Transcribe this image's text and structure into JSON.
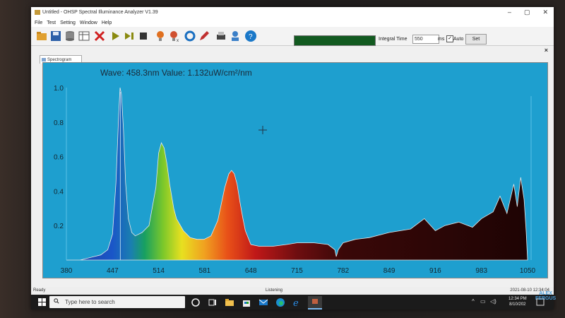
{
  "window": {
    "title": "Untitled - OHSP Spectral Illuminance Analyzer V1.39",
    "controls": [
      "–",
      "▢",
      "✕"
    ]
  },
  "menu": [
    "File",
    "Test",
    "Setting",
    "Window",
    "Help"
  ],
  "toolbar": {
    "icons": [
      "open-icon",
      "save-icon",
      "database-icon",
      "table-icon",
      "delete-icon",
      "play-icon",
      "step-icon",
      "stop-icon",
      "bulb-icon",
      "bulb-x-icon",
      "refresh-icon",
      "edit-icon",
      "print-icon",
      "user-icon",
      "help-icon"
    ],
    "progress": 1.0,
    "integral_time_label": "Integral Time",
    "integral_time_value": "550",
    "ms_label": "ms",
    "auto_label": "Auto",
    "auto_checked": true,
    "set_label": "Set"
  },
  "panel": {
    "close": "×",
    "tab_label": "Spectrogram"
  },
  "readout": "Wave: 458.3nm  Value: 1.132uW/cm²/nm",
  "chart_data": {
    "type": "area",
    "title": "",
    "xlabel": "",
    "ylabel": "",
    "xlim": [
      380,
      1050
    ],
    "ylim": [
      0,
      1.0
    ],
    "x_ticks": [
      "380",
      "447",
      "514",
      "581",
      "648",
      "715",
      "782",
      "849",
      "916",
      "983",
      "1050"
    ],
    "y_ticks": [
      "1.0",
      "0.8",
      "0.6",
      "0.4",
      "0.2"
    ],
    "x": [
      380,
      400,
      420,
      430,
      440,
      447,
      452,
      456,
      458,
      460,
      463,
      466,
      470,
      475,
      480,
      490,
      500,
      510,
      514,
      518,
      522,
      526,
      530,
      536,
      540,
      550,
      560,
      570,
      580,
      590,
      600,
      610,
      616,
      620,
      624,
      628,
      632,
      636,
      640,
      648,
      660,
      680,
      700,
      715,
      740,
      760,
      770,
      772,
      775,
      782,
      800,
      820,
      849,
      880,
      900,
      916,
      930,
      950,
      970,
      983,
      1000,
      1010,
      1020,
      1030,
      1035,
      1040,
      1045,
      1048,
      1050
    ],
    "values": [
      0.0,
      0.0,
      0.02,
      0.03,
      0.06,
      0.15,
      0.45,
      0.85,
      1.0,
      0.96,
      0.75,
      0.45,
      0.24,
      0.16,
      0.14,
      0.16,
      0.2,
      0.42,
      0.62,
      0.68,
      0.65,
      0.56,
      0.44,
      0.3,
      0.24,
      0.17,
      0.13,
      0.12,
      0.12,
      0.14,
      0.23,
      0.42,
      0.5,
      0.52,
      0.5,
      0.44,
      0.34,
      0.25,
      0.17,
      0.09,
      0.08,
      0.08,
      0.09,
      0.1,
      0.1,
      0.09,
      0.06,
      0.02,
      0.06,
      0.1,
      0.12,
      0.13,
      0.16,
      0.18,
      0.24,
      0.17,
      0.2,
      0.22,
      0.19,
      0.24,
      0.28,
      0.37,
      0.27,
      0.44,
      0.31,
      0.48,
      0.35,
      0.16,
      0.0
    ],
    "cursor": {
      "x": 458.3,
      "y": 1.132
    },
    "grid": false,
    "legend": "none"
  },
  "status": {
    "left": "Ready",
    "center": "Listening",
    "right": "2021-08-10 12:34:04"
  },
  "taskbar": {
    "search_placeholder": "Type here to search",
    "time": "12:34 PM",
    "date": "8/10/202",
    "icons": [
      "task-view-icon",
      "file-explorer-icon",
      "store-icon",
      "mail-icon",
      "edge-icon",
      "ie-icon",
      "app-icon"
    ]
  },
  "watermark": {
    "line1": "ALEX",
    "line2": "FERGUS"
  },
  "colors": {
    "plot_bg": "#1e9fcf",
    "accent": "#0b6fb3"
  }
}
